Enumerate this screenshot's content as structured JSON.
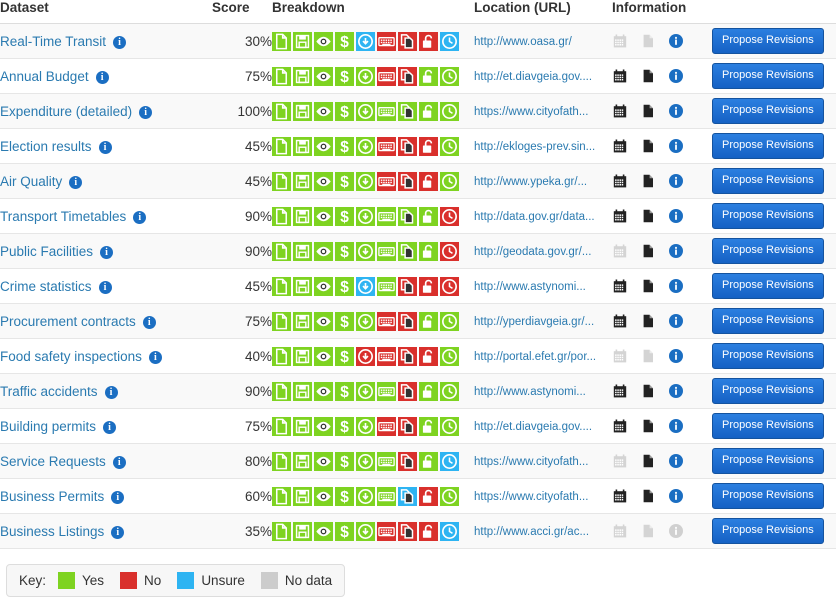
{
  "table": {
    "columns": [
      {
        "key": "dataset",
        "label": "Dataset"
      },
      {
        "key": "score",
        "label": "Score"
      },
      {
        "key": "breakdown",
        "label": "Breakdown"
      },
      {
        "key": "url",
        "label": "Location (URL)"
      },
      {
        "key": "information",
        "label": "Information"
      },
      {
        "key": "action",
        "label": ""
      }
    ],
    "breakdown_icons": [
      "file-icon",
      "save-icon",
      "eye-icon",
      "dollar-icon",
      "download-circle-icon",
      "keyboard-icon",
      "copy-icon",
      "unlock-icon",
      "clock-icon"
    ],
    "information_icons": [
      "calendar-icon",
      "document-icon",
      "info-icon"
    ],
    "action_label": "Propose Revisions",
    "rows": [
      {
        "dataset": "Real-Time Transit",
        "score": "30%",
        "url": "http://www.oasa.gr/",
        "breakdown": [
          "yes",
          "yes",
          "yes",
          "yes",
          "unsure",
          "no",
          "no",
          "no",
          "unsure"
        ],
        "information": [
          "off",
          "off",
          "on"
        ]
      },
      {
        "dataset": "Annual Budget",
        "score": "75%",
        "url": "http://et.diavgeia.gov....",
        "breakdown": [
          "yes",
          "yes",
          "yes",
          "yes",
          "yes",
          "no",
          "no",
          "yes",
          "yes"
        ],
        "information": [
          "on",
          "on",
          "on"
        ]
      },
      {
        "dataset": "Expenditure (detailed)",
        "score": "100%",
        "url": "https://www.cityofath...",
        "breakdown": [
          "yes",
          "yes",
          "yes",
          "yes",
          "yes",
          "yes",
          "yes",
          "yes",
          "yes"
        ],
        "information": [
          "on",
          "on",
          "on"
        ]
      },
      {
        "dataset": "Election results",
        "score": "45%",
        "url": "http://ekloges-prev.sin...",
        "breakdown": [
          "yes",
          "yes",
          "yes",
          "yes",
          "yes",
          "no",
          "no",
          "no",
          "yes"
        ],
        "information": [
          "on",
          "on",
          "on"
        ]
      },
      {
        "dataset": "Air Quality",
        "score": "45%",
        "url": "http://www.ypeka.gr/...",
        "breakdown": [
          "yes",
          "yes",
          "yes",
          "yes",
          "yes",
          "no",
          "no",
          "no",
          "yes"
        ],
        "information": [
          "on",
          "on",
          "on"
        ]
      },
      {
        "dataset": "Transport Timetables",
        "score": "90%",
        "url": "http://data.gov.gr/data...",
        "breakdown": [
          "yes",
          "yes",
          "yes",
          "yes",
          "yes",
          "yes",
          "yes",
          "yes",
          "no"
        ],
        "information": [
          "on",
          "on",
          "on"
        ]
      },
      {
        "dataset": "Public Facilities",
        "score": "90%",
        "url": "http://geodata.gov.gr/...",
        "breakdown": [
          "yes",
          "yes",
          "yes",
          "yes",
          "yes",
          "yes",
          "yes",
          "yes",
          "no"
        ],
        "information": [
          "off",
          "on",
          "on"
        ]
      },
      {
        "dataset": "Crime statistics",
        "score": "45%",
        "url": "http://www.astynomi...",
        "breakdown": [
          "yes",
          "yes",
          "yes",
          "yes",
          "unsure",
          "yes",
          "no",
          "no",
          "no"
        ],
        "information": [
          "on",
          "on",
          "on"
        ]
      },
      {
        "dataset": "Procurement contracts",
        "score": "75%",
        "url": "http://yperdiavgeia.gr/...",
        "breakdown": [
          "yes",
          "yes",
          "yes",
          "yes",
          "yes",
          "no",
          "no",
          "yes",
          "yes"
        ],
        "information": [
          "on",
          "on",
          "on"
        ]
      },
      {
        "dataset": "Food safety inspections",
        "score": "40%",
        "url": "http://portal.efet.gr/por...",
        "breakdown": [
          "yes",
          "yes",
          "yes",
          "yes",
          "no",
          "no",
          "no",
          "no",
          "yes"
        ],
        "information": [
          "off",
          "off",
          "on"
        ]
      },
      {
        "dataset": "Traffic accidents",
        "score": "90%",
        "url": "http://www.astynomi...",
        "breakdown": [
          "yes",
          "yes",
          "yes",
          "yes",
          "yes",
          "yes",
          "no",
          "yes",
          "yes"
        ],
        "information": [
          "on",
          "on",
          "on"
        ]
      },
      {
        "dataset": "Building permits",
        "score": "75%",
        "url": "http://et.diavgeia.gov....",
        "breakdown": [
          "yes",
          "yes",
          "yes",
          "yes",
          "yes",
          "no",
          "no",
          "yes",
          "yes"
        ],
        "information": [
          "on",
          "on",
          "on"
        ]
      },
      {
        "dataset": "Service Requests",
        "score": "80%",
        "url": "https://www.cityofath...",
        "breakdown": [
          "yes",
          "yes",
          "yes",
          "yes",
          "yes",
          "yes",
          "no",
          "yes",
          "unsure"
        ],
        "information": [
          "off",
          "on",
          "on"
        ]
      },
      {
        "dataset": "Business Permits",
        "score": "60%",
        "url": "https://www.cityofath...",
        "breakdown": [
          "yes",
          "yes",
          "yes",
          "yes",
          "yes",
          "yes",
          "unsure",
          "no",
          "yes"
        ],
        "information": [
          "on",
          "on",
          "on"
        ]
      },
      {
        "dataset": "Business Listings",
        "score": "35%",
        "url": "http://www.acci.gr/ac...",
        "breakdown": [
          "yes",
          "yes",
          "yes",
          "yes",
          "yes",
          "no",
          "no",
          "no",
          "unsure"
        ],
        "information": [
          "off",
          "off",
          "off"
        ]
      }
    ]
  },
  "key": {
    "label": "Key:",
    "items": [
      {
        "state": "yes",
        "label": "Yes",
        "color": "#7ed321"
      },
      {
        "state": "no",
        "label": "No",
        "color": "#d9302c"
      },
      {
        "state": "unsure",
        "label": "Unsure",
        "color": "#2eb4f2"
      },
      {
        "state": "nodata",
        "label": "No data",
        "color": "#cccccc"
      }
    ]
  },
  "colors": {
    "yes": "#7ed321",
    "no": "#d9302c",
    "unsure": "#2eb4f2",
    "nodata": "#cccccc",
    "link": "#2a7ab0",
    "button": "#1f6fd0",
    "info_blue": "#1b6ec2"
  }
}
